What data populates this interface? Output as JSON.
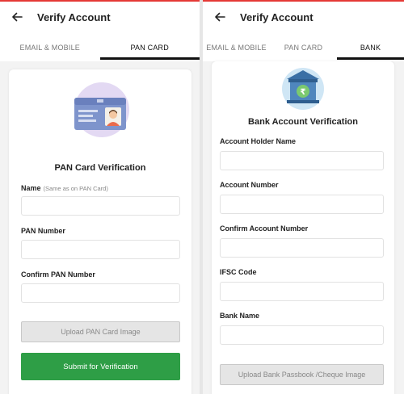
{
  "left": {
    "header": {
      "title": "Verify Account"
    },
    "tabs": [
      {
        "label": "EMAIL & MOBILE",
        "active": false
      },
      {
        "label": "PAN CARD",
        "active": true
      }
    ],
    "heading": "PAN Card Verification",
    "fields": [
      {
        "label": "Name",
        "hint": "(Same as on PAN Card)",
        "value": ""
      },
      {
        "label": "PAN Number",
        "value": ""
      },
      {
        "label": "Confirm PAN Number",
        "value": ""
      }
    ],
    "upload_label": "Upload PAN Card Image",
    "submit_label": "Submit for Verification"
  },
  "right": {
    "header": {
      "title": "Verify Account"
    },
    "tabs": [
      {
        "label": "EMAIL & MOBILE",
        "active": false
      },
      {
        "label": "PAN CARD",
        "active": false
      },
      {
        "label": "BANK",
        "active": true
      }
    ],
    "heading": "Bank Account Verification",
    "fields": [
      {
        "label": "Account Holder Name",
        "value": ""
      },
      {
        "label": "Account Number",
        "value": ""
      },
      {
        "label": "Confirm Account Number",
        "value": ""
      },
      {
        "label": "IFSC Code",
        "value": ""
      },
      {
        "label": "Bank Name",
        "value": ""
      }
    ],
    "upload_label": "Upload Bank Passbook /Cheque Image"
  },
  "icons": {
    "back": "arrow-left-icon",
    "pan_card": "pan-card-illustration-icon",
    "bank": "bank-rupee-illustration-icon"
  },
  "colors": {
    "accent_red": "#e53935",
    "submit_green": "#2e9e46",
    "tab_underline": "#111111",
    "illustration_bg": "#e3d9f3",
    "bank_bg": "#cfe6f5"
  }
}
